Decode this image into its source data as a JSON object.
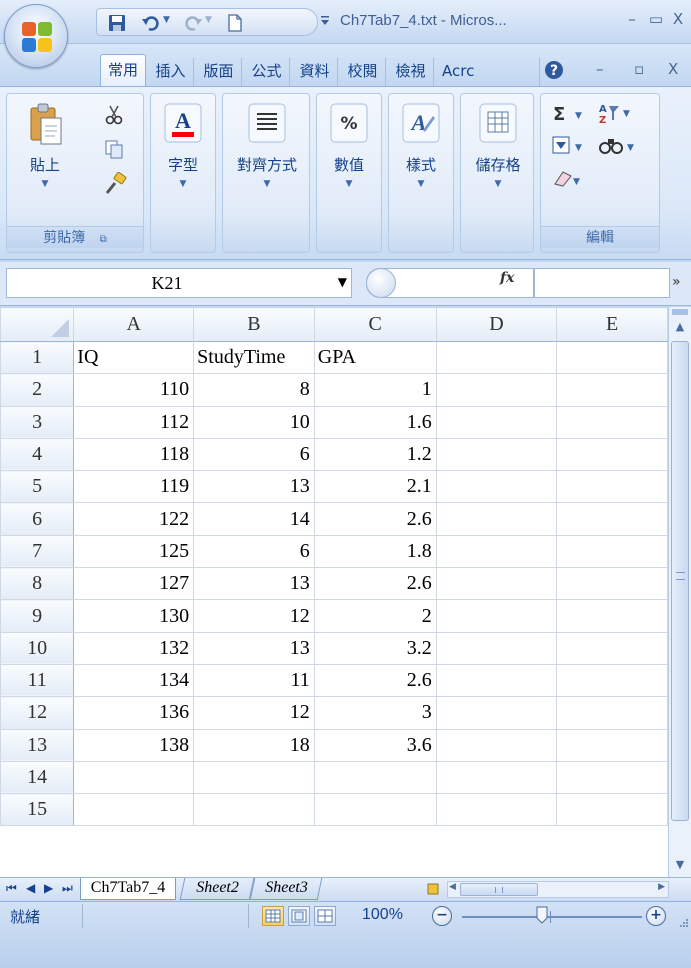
{
  "window": {
    "title": "Ch7Tab7_4.txt - Micros...",
    "minimize": "–",
    "maximize": "▭",
    "close": "X"
  },
  "ribbon_tabs": [
    "常用",
    "插入",
    "版面",
    "公式",
    "資料",
    "校閱",
    "檢視",
    "Acrc"
  ],
  "ribbon_tab_controls": {
    "minimize": "–",
    "restore": "▫",
    "close": "X"
  },
  "ribbon": {
    "paste_label": "貼上",
    "clipboard_group": "剪貼簿",
    "font_label": "字型",
    "alignment_label": "對齊方式",
    "number_label": "數值",
    "styles_label": "樣式",
    "cells_label": "儲存格",
    "editing_group": "編輯"
  },
  "formula_bar": {
    "name_box": "K21",
    "fx": "fx",
    "formula_value": ""
  },
  "grid": {
    "columns": [
      "A",
      "B",
      "C",
      "D",
      "E"
    ],
    "rows": [
      {
        "n": "1",
        "A": "IQ",
        "B": "StudyTime",
        "C": "GPA",
        "D": "",
        "E": ""
      },
      {
        "n": "2",
        "A": "110",
        "B": "8",
        "C": "1",
        "D": "",
        "E": ""
      },
      {
        "n": "3",
        "A": "112",
        "B": "10",
        "C": "1.6",
        "D": "",
        "E": ""
      },
      {
        "n": "4",
        "A": "118",
        "B": "6",
        "C": "1.2",
        "D": "",
        "E": ""
      },
      {
        "n": "5",
        "A": "119",
        "B": "13",
        "C": "2.1",
        "D": "",
        "E": ""
      },
      {
        "n": "6",
        "A": "122",
        "B": "14",
        "C": "2.6",
        "D": "",
        "E": ""
      },
      {
        "n": "7",
        "A": "125",
        "B": "6",
        "C": "1.8",
        "D": "",
        "E": ""
      },
      {
        "n": "8",
        "A": "127",
        "B": "13",
        "C": "2.6",
        "D": "",
        "E": ""
      },
      {
        "n": "9",
        "A": "130",
        "B": "12",
        "C": "2",
        "D": "",
        "E": ""
      },
      {
        "n": "10",
        "A": "132",
        "B": "13",
        "C": "3.2",
        "D": "",
        "E": ""
      },
      {
        "n": "11",
        "A": "134",
        "B": "11",
        "C": "2.6",
        "D": "",
        "E": ""
      },
      {
        "n": "12",
        "A": "136",
        "B": "12",
        "C": "3",
        "D": "",
        "E": ""
      },
      {
        "n": "13",
        "A": "138",
        "B": "18",
        "C": "3.6",
        "D": "",
        "E": ""
      },
      {
        "n": "14",
        "A": "",
        "B": "",
        "C": "",
        "D": "",
        "E": ""
      },
      {
        "n": "15",
        "A": "",
        "B": "",
        "C": "",
        "D": "",
        "E": ""
      }
    ]
  },
  "sheets": [
    "Ch7Tab7_4",
    "Sheet2",
    "Sheet3"
  ],
  "sheet_nav": {
    "first": "⏮",
    "prev": "◀",
    "next": "▶",
    "last": "⏭"
  },
  "status": {
    "ready": "就緒",
    "zoom": "100%",
    "zoom_minus": "−",
    "zoom_plus": "+"
  },
  "colors": {
    "accent": "#15428b",
    "ribbon_bg": "#dbe8f8",
    "font_color_bar": "#ff0000"
  }
}
